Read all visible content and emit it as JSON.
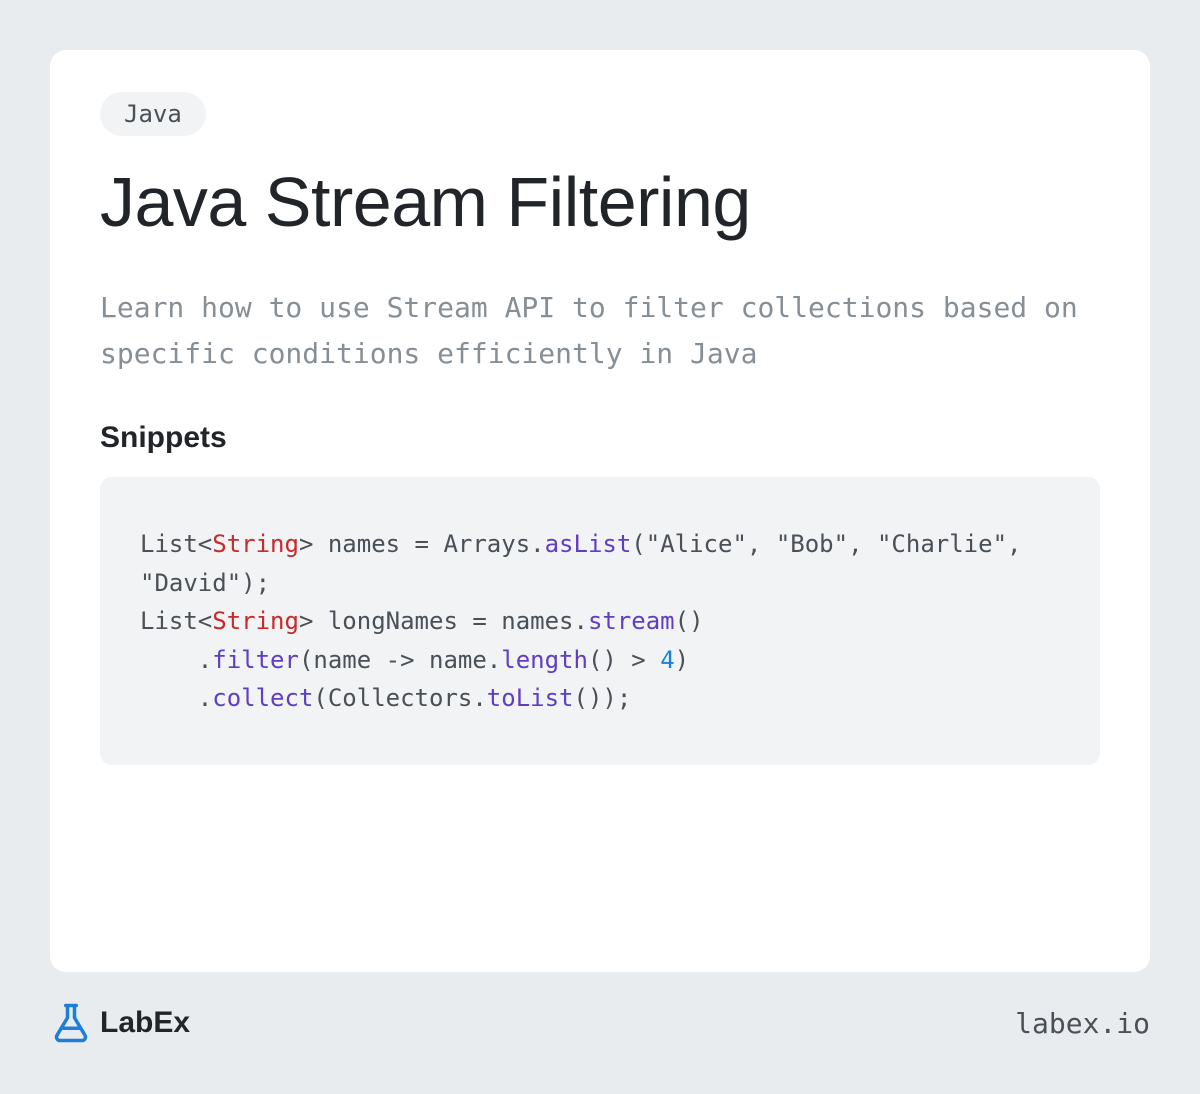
{
  "tag": "Java",
  "title": "Java Stream Filtering",
  "description": "Learn how to use Stream API to filter collections based on specific conditions efficiently in Java",
  "section_heading": "Snippets",
  "code": {
    "tokens": [
      {
        "text": "List<",
        "cls": ""
      },
      {
        "text": "String",
        "cls": "token-type"
      },
      {
        "text": "> names = Arrays.",
        "cls": ""
      },
      {
        "text": "asList",
        "cls": "token-method"
      },
      {
        "text": "(",
        "cls": ""
      },
      {
        "text": "\"Alice\"",
        "cls": "token-string"
      },
      {
        "text": ", ",
        "cls": ""
      },
      {
        "text": "\"Bob\"",
        "cls": "token-string"
      },
      {
        "text": ", ",
        "cls": ""
      },
      {
        "text": "\"Charlie\"",
        "cls": "token-string"
      },
      {
        "text": ", ",
        "cls": ""
      },
      {
        "text": "\"David\"",
        "cls": "token-string"
      },
      {
        "text": ");\nList<",
        "cls": ""
      },
      {
        "text": "String",
        "cls": "token-type"
      },
      {
        "text": "> longNames = names.",
        "cls": ""
      },
      {
        "text": "stream",
        "cls": "token-method"
      },
      {
        "text": "()\n    .",
        "cls": ""
      },
      {
        "text": "filter",
        "cls": "token-method"
      },
      {
        "text": "(name -> name.",
        "cls": ""
      },
      {
        "text": "length",
        "cls": "token-method"
      },
      {
        "text": "() > ",
        "cls": ""
      },
      {
        "text": "4",
        "cls": "token-number"
      },
      {
        "text": ")\n    .",
        "cls": ""
      },
      {
        "text": "collect",
        "cls": "token-method"
      },
      {
        "text": "(Collectors.",
        "cls": ""
      },
      {
        "text": "toList",
        "cls": "token-method"
      },
      {
        "text": "());",
        "cls": ""
      }
    ]
  },
  "brand": "LabEx",
  "site_url": "labex.io"
}
